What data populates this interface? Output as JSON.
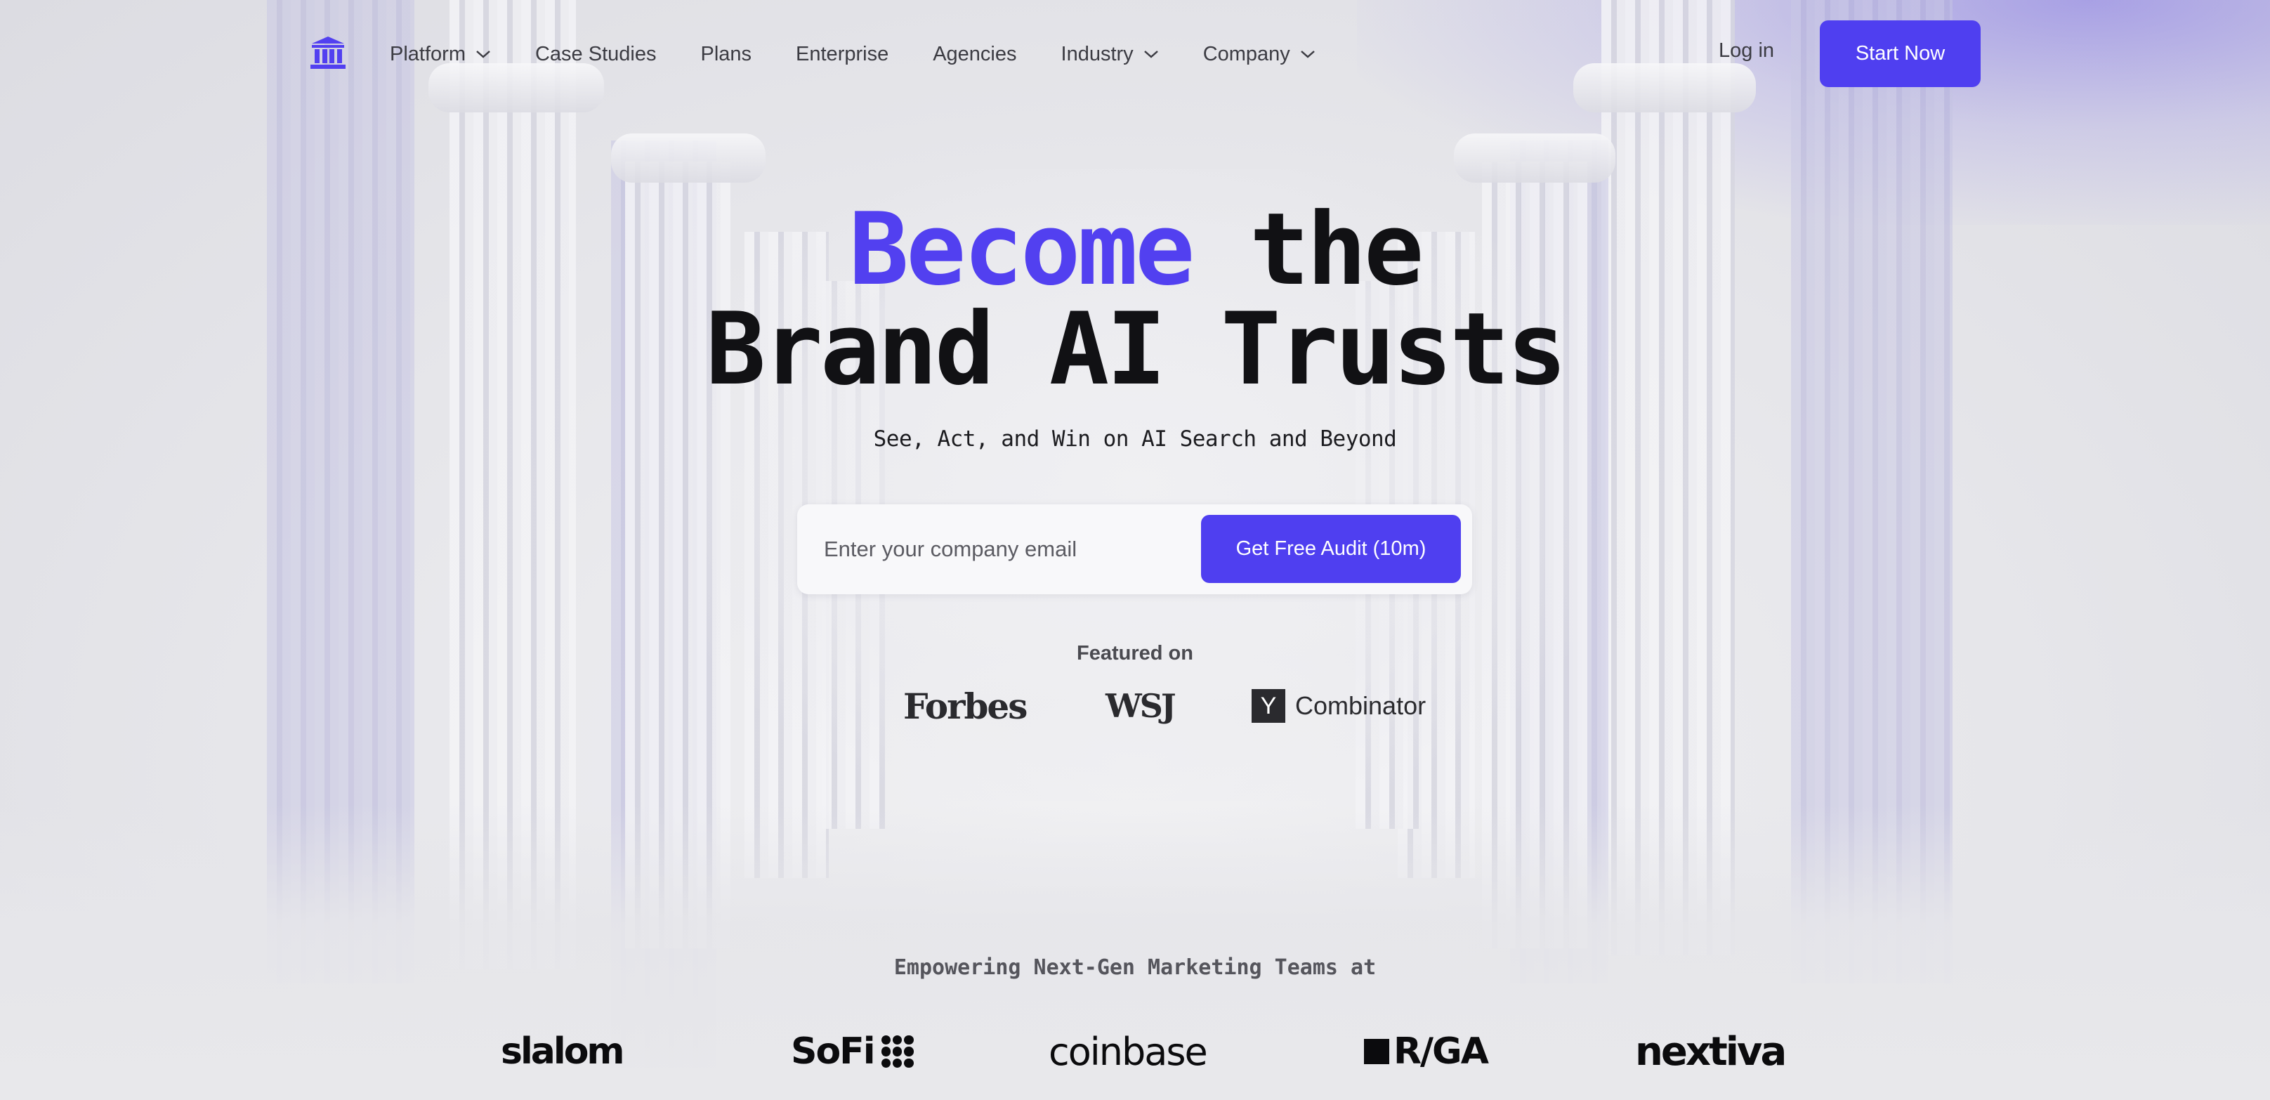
{
  "nav": {
    "logo_icon": "bank-columns-icon",
    "items": [
      {
        "label": "Platform",
        "has_dropdown": true
      },
      {
        "label": "Case Studies",
        "has_dropdown": false
      },
      {
        "label": "Plans",
        "has_dropdown": false
      },
      {
        "label": "Enterprise",
        "has_dropdown": false
      },
      {
        "label": "Agencies",
        "has_dropdown": false
      },
      {
        "label": "Industry",
        "has_dropdown": true
      },
      {
        "label": "Company",
        "has_dropdown": true
      }
    ],
    "login_label": "Log in",
    "start_label": "Start Now"
  },
  "hero": {
    "title_accent": "Become",
    "title_rest": " the",
    "title_line2": "Brand AI Trusts",
    "subtitle": "See, Act, and Win on AI Search and Beyond",
    "email_placeholder": "Enter your company email",
    "email_value": "",
    "cta_label": "Get Free Audit (10m)"
  },
  "featured": {
    "label": "Featured on",
    "outlets": [
      "Forbes",
      "WSJ"
    ],
    "yc_mark": "Y",
    "yc_text": "Combinator"
  },
  "customers": {
    "label": "Empowering Next-Gen Marketing Teams at",
    "logos": [
      "slalom",
      "SoFi",
      "coinbase",
      "R/GA",
      "nextiva"
    ]
  },
  "colors": {
    "accent": "#4f3ff0",
    "title_accent": "#5240f0",
    "text_dark": "#111114"
  }
}
